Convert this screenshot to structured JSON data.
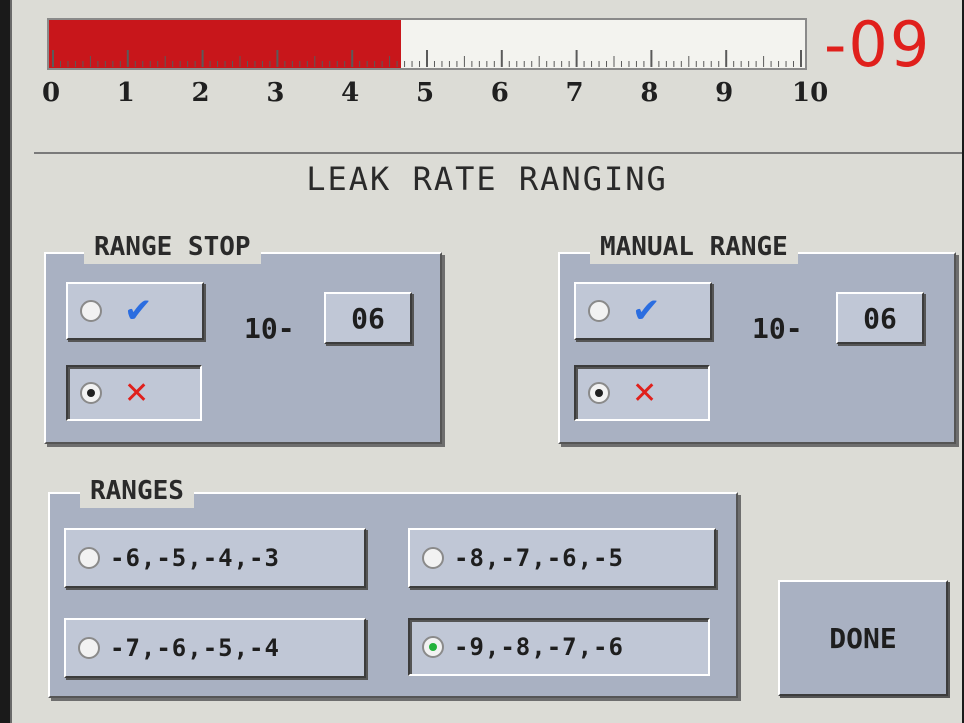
{
  "leak_bar": {
    "value_text": "-09",
    "fill_fraction": 0.465,
    "scale_labels": [
      "0",
      "1",
      "2",
      "3",
      "4",
      "5",
      "6",
      "7",
      "8",
      "9",
      "10"
    ],
    "fill_color": "#c8161b"
  },
  "title": "LEAK RATE RANGING",
  "range_stop": {
    "label": "RANGE STOP",
    "enable_icon": "check-icon",
    "disable_icon": "x-icon",
    "selected": "disable",
    "exp_prefix": "10-",
    "exp_value": "06"
  },
  "manual_range": {
    "label": "MANUAL RANGE",
    "enable_icon": "check-icon",
    "disable_icon": "x-icon",
    "selected": "disable",
    "exp_prefix": "10-",
    "exp_value": "06"
  },
  "ranges": {
    "label": "RANGES",
    "options": [
      {
        "text": "-6,-5,-4,-3",
        "selected": false
      },
      {
        "text": "-8,-7,-6,-5",
        "selected": false
      },
      {
        "text": "-7,-6,-5,-4",
        "selected": false
      },
      {
        "text": "-9,-8,-7,-6",
        "selected": true
      }
    ]
  },
  "done_label": "DONE",
  "icons": {
    "check": "✔",
    "x": "✕"
  }
}
